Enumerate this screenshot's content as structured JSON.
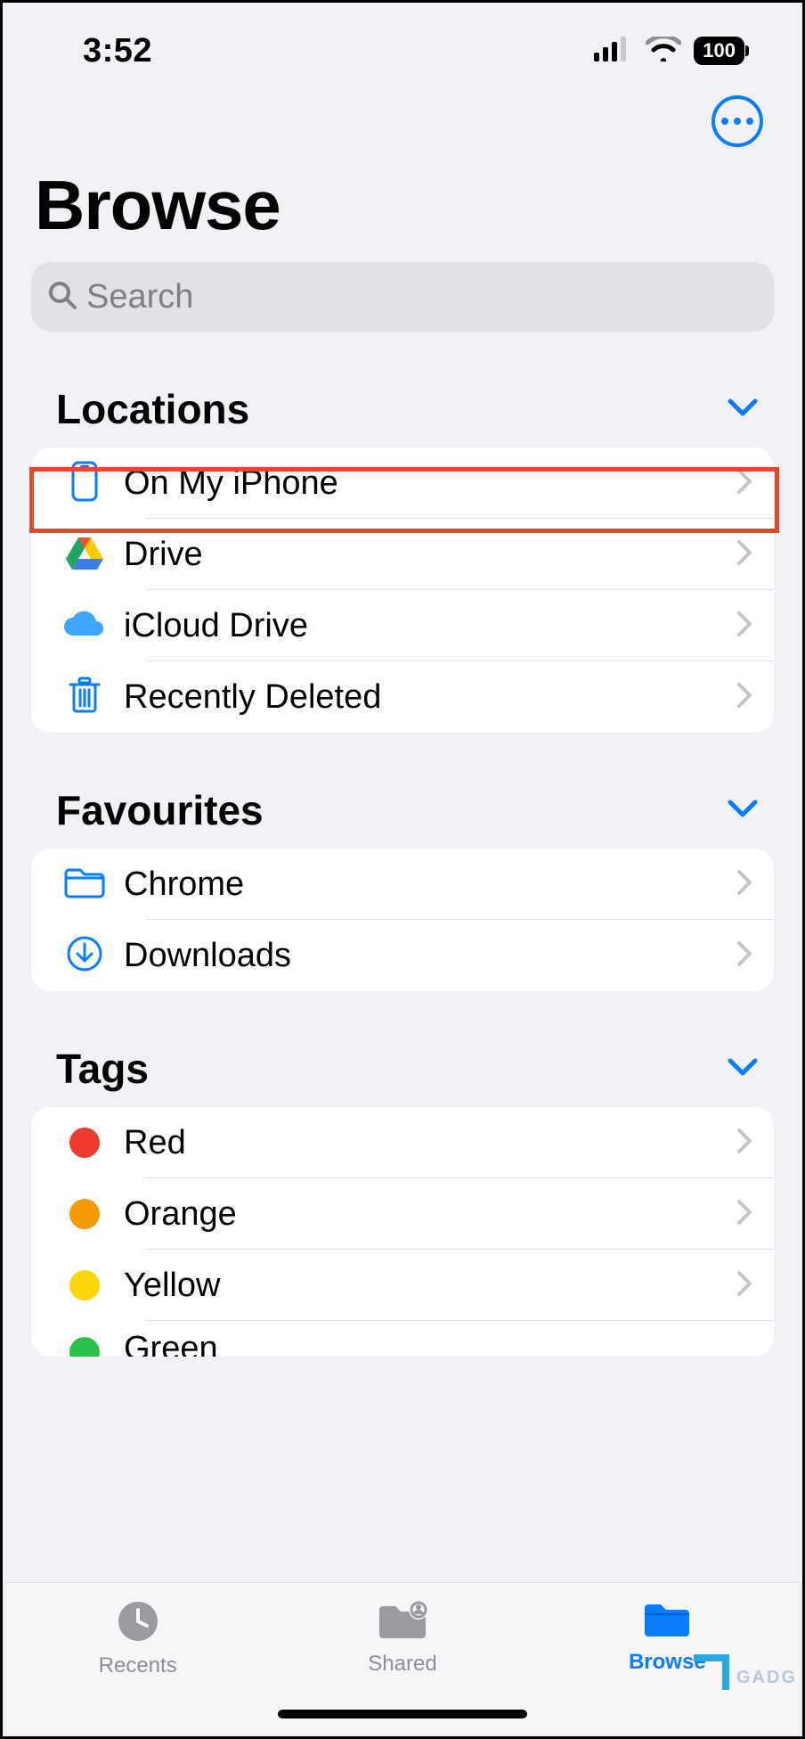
{
  "status": {
    "time": "3:52",
    "battery": "100"
  },
  "page_title": "Browse",
  "search": {
    "placeholder": "Search"
  },
  "sections": {
    "locations": {
      "title": "Locations",
      "items": [
        {
          "label": "On My iPhone",
          "icon": "iphone-icon"
        },
        {
          "label": "Drive",
          "icon": "google-drive-icon"
        },
        {
          "label": "iCloud Drive",
          "icon": "icloud-icon"
        },
        {
          "label": "Recently Deleted",
          "icon": "trash-icon"
        }
      ]
    },
    "favourites": {
      "title": "Favourites",
      "items": [
        {
          "label": "Chrome",
          "icon": "folder-icon"
        },
        {
          "label": "Downloads",
          "icon": "download-circle-icon"
        }
      ]
    },
    "tags": {
      "title": "Tags",
      "items": [
        {
          "label": "Red",
          "color": "#ef3b30"
        },
        {
          "label": "Orange",
          "color": "#f59b00"
        },
        {
          "label": "Yellow",
          "color": "#fed709"
        },
        {
          "label": "Green",
          "color": "#2bbf4c"
        }
      ]
    }
  },
  "tabs": {
    "recents": "Recents",
    "shared": "Shared",
    "browse": "Browse"
  }
}
